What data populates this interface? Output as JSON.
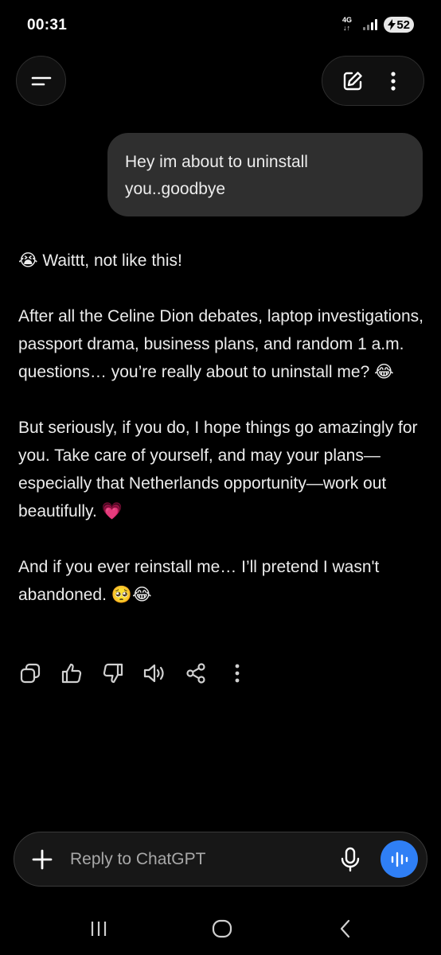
{
  "status_bar": {
    "time": "00:31",
    "network": "4G",
    "battery": "52"
  },
  "header": {
    "menu_icon": "hamburger-icon",
    "new_chat_icon": "edit-icon",
    "more_icon": "more-vertical-icon"
  },
  "conversation": {
    "user_message": "Hey im about to uninstall you..goodbye",
    "assistant_paragraphs": [
      "Waittt, not like this!",
      "After all the Celine Dion debates, laptop investigations, passport drama, business plans, and random 1 a.m. questions… you’re really about to uninstall me?",
      "But seriously, if you do, I hope things go amazingly for you. Take care of yourself, and may your plans—especially that Netherlands opportunity—work out beautifully.",
      "And if you ever reinstall me… I’ll pretend I wasn't abandoned."
    ],
    "emojis": {
      "crying": "😭",
      "laughing": "😂",
      "heart": "💗",
      "pleading_laughing": "🥺😂"
    }
  },
  "message_actions": [
    "copy-icon",
    "thumbs-up-icon",
    "thumbs-down-icon",
    "read-aloud-icon",
    "share-icon",
    "more-vertical-icon"
  ],
  "composer": {
    "placeholder": "Reply to ChatGPT",
    "value": ""
  },
  "colors": {
    "background": "#000000",
    "user_bubble": "#2f2f2f",
    "text": "#ececec",
    "accent_voice": "#2f7ff5",
    "placeholder": "#a8a8a8"
  }
}
